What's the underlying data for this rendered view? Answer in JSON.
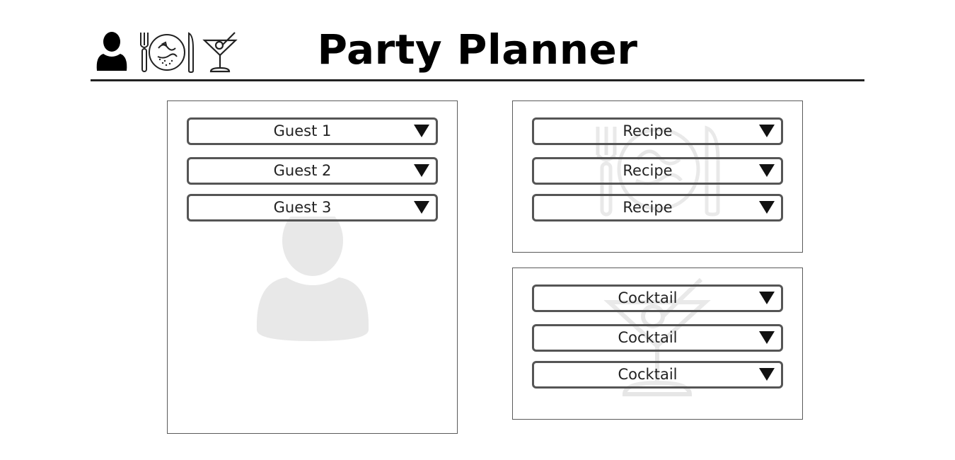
{
  "header": {
    "title": "Party Planner",
    "icons": [
      "user-icon",
      "plate-icon",
      "cocktail-icon"
    ]
  },
  "guests_panel": {
    "watermark_icon": "user-icon",
    "dropdowns": [
      {
        "selected": "Guest 1",
        "icon": "triangle-down-icon"
      },
      {
        "selected": "Guest 2",
        "icon": "triangle-down-icon"
      },
      {
        "selected": "Guest 3",
        "icon": "triangle-down-icon"
      }
    ]
  },
  "recipes_panel": {
    "watermark_icon": "plate-icon",
    "dropdowns": [
      {
        "selected": "Recipe",
        "icon": "triangle-down-icon"
      },
      {
        "selected": "Recipe",
        "icon": "triangle-down-icon"
      },
      {
        "selected": "Recipe",
        "icon": "triangle-down-icon"
      }
    ]
  },
  "cocktails_panel": {
    "watermark_icon": "cocktail-icon",
    "dropdowns": [
      {
        "selected": "Cocktail",
        "icon": "triangle-down-icon"
      },
      {
        "selected": "Cocktail",
        "icon": "triangle-down-icon"
      },
      {
        "selected": "Cocktail",
        "icon": "triangle-down-icon"
      }
    ]
  },
  "colors": {
    "ink": "#000000",
    "border": "#555555",
    "watermark": "#e8e8e8"
  }
}
